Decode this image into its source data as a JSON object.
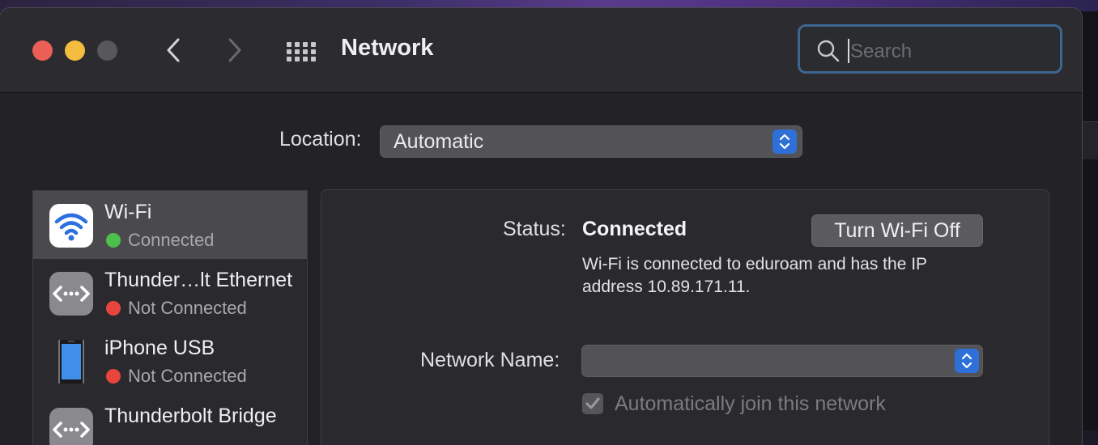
{
  "window": {
    "title": "Network",
    "search": {
      "placeholder": "Search",
      "value": ""
    }
  },
  "location": {
    "label": "Location:",
    "value": "Automatic"
  },
  "services": [
    {
      "name": "Wi-Fi",
      "status": "Connected",
      "status_color": "#4cc04a",
      "selected": true,
      "icon": "wifi-icon"
    },
    {
      "name": "Thunder…lt Ethernet",
      "status": "Not Connected",
      "status_color": "#e8453c",
      "selected": false,
      "icon": "ethernet-icon"
    },
    {
      "name": "iPhone USB",
      "status": "Not Connected",
      "status_color": "#e8453c",
      "selected": false,
      "icon": "iphone-icon"
    },
    {
      "name": "Thunderbolt Bridge",
      "status": "",
      "status_color": "",
      "selected": false,
      "icon": "bridge-icon"
    }
  ],
  "detail": {
    "status_label": "Status:",
    "status_value": "Connected",
    "toggle_button": "Turn Wi-Fi Off",
    "description_line1": "Wi-Fi is connected to eduroam and has the IP",
    "description_line2": "address 10.89.171.11.",
    "network_name_label": "Network Name:",
    "network_name_value": "",
    "auto_join_label": "Automatically join this network",
    "auto_join_checked": true
  },
  "colors": {
    "accent": "#2f6fd8",
    "search_focus": "#3d6690",
    "close": "#ec5f56",
    "minimize": "#f4bd3f"
  }
}
